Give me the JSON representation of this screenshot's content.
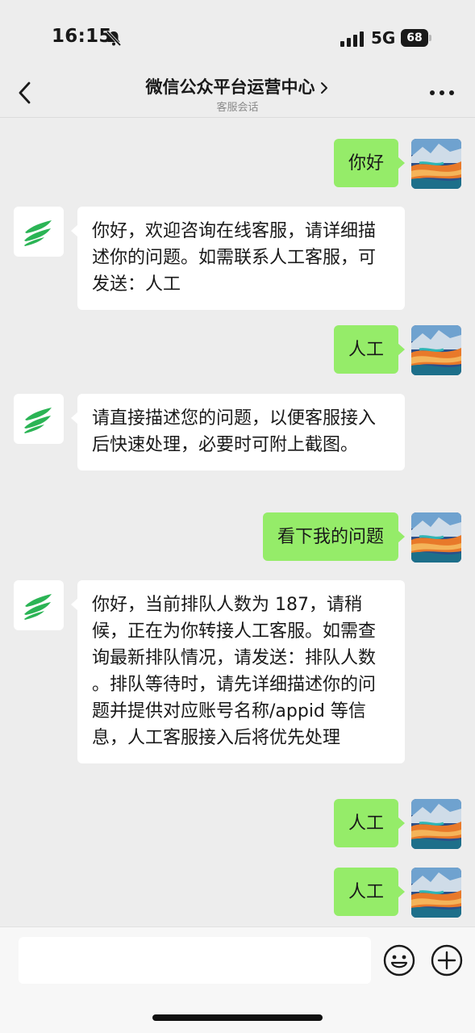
{
  "status_bar": {
    "time": "16:15",
    "network": "5G",
    "battery": "68"
  },
  "header": {
    "title": "微信公众平台运营中心",
    "subtitle": "客服会话"
  },
  "messages": [
    {
      "from": "user",
      "text": "你好"
    },
    {
      "from": "bot",
      "text": "你好，欢迎咨询在线客服，请详细描述你的问题。如需联系人工客服，可发送：人工"
    },
    {
      "from": "user",
      "text": "人工"
    },
    {
      "from": "bot",
      "text": "请直接描述您的问题，以便客服接入后快速处理，必要时可附上截图。"
    },
    {
      "from": "user",
      "text": "看下我的问题"
    },
    {
      "from": "bot",
      "text": "你好，当前排队人数为 187，请稍候，正在为你转接人工客服。如需查询最新排队情况，请发送：排队人数 。排队等待时，请先详细描述你的问题并提供对应账号名称/appid 等信息，人工客服接入后将优先处理"
    },
    {
      "from": "user",
      "text": "人工"
    },
    {
      "from": "user",
      "text": "人工"
    }
  ],
  "input": {
    "placeholder": ""
  },
  "icons": {
    "back": "chevron-left-icon",
    "more": "more-dots-icon",
    "emoji": "emoji-icon",
    "plus": "plus-circle-icon",
    "bot_avatar": "green-leaf-logo-icon"
  },
  "colors": {
    "background": "#ededed",
    "user_bubble": "#95ec69",
    "bot_bubble": "#ffffff",
    "logo_green": "#2bb455"
  }
}
